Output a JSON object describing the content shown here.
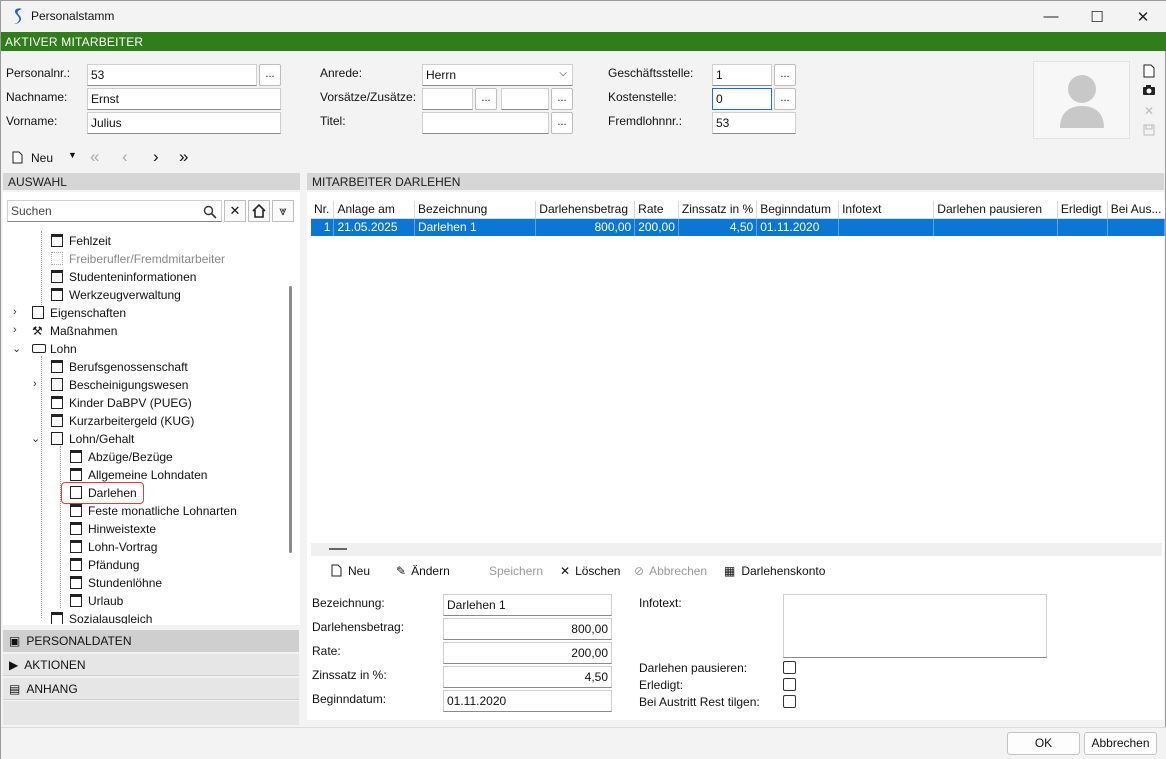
{
  "window": {
    "title": "Personalstamm",
    "minimize": "—",
    "maximize": "☐",
    "close": "✕"
  },
  "header": {
    "active_label": "AKTIVER MITARBEITER"
  },
  "form": {
    "personalnr_label": "Personalnr.:",
    "personalnr_value": "53",
    "nachname_label": "Nachname:",
    "nachname_value": "Ernst",
    "vorname_label": "Vorname:",
    "vorname_value": "Julius",
    "anrede_label": "Anrede:",
    "anrede_value": "Herrn",
    "vorsaetze_label": "Vorsätze/Zusätze:",
    "vorsaetze_value1": "",
    "vorsaetze_value2": "",
    "titel_label": "Titel:",
    "titel_value": "",
    "geschaeftsstelle_label": "Geschäftsstelle:",
    "geschaeftsstelle_value": "1",
    "kostenstelle_label": "Kostenstelle:",
    "kostenstelle_value": "0",
    "fremdlohn_label": "Fremdlohnnr.:",
    "fremdlohn_value": "53",
    "dots": "..."
  },
  "nav": {
    "new_label": "Neu",
    "first": "«",
    "prev": "‹",
    "next": "›",
    "last": "»"
  },
  "left": {
    "section_title": "AUSWAHL",
    "search_placeholder": "Suchen",
    "tree": [
      {
        "label": "Fehlzeit"
      },
      {
        "label": "Freiberufler/Fremdmitarbeiter"
      },
      {
        "label": "Studenteninformationen"
      },
      {
        "label": "Werkzeugverwaltung"
      },
      {
        "label": "Eigenschaften"
      },
      {
        "label": "Maßnahmen"
      },
      {
        "label": "Lohn"
      },
      {
        "label": "Berufsgenossenschaft"
      },
      {
        "label": "Bescheinigungswesen"
      },
      {
        "label": "Kinder DaBPV (PUEG)"
      },
      {
        "label": "Kurzarbeitergeld (KUG)"
      },
      {
        "label": "Lohn/Gehalt"
      },
      {
        "label": "Abzüge/Bezüge"
      },
      {
        "label": "Allgemeine Lohndaten"
      },
      {
        "label": "Darlehen"
      },
      {
        "label": "Feste monatliche Lohnarten"
      },
      {
        "label": "Hinweistexte"
      },
      {
        "label": "Lohn-Vortrag"
      },
      {
        "label": "Pfändung"
      },
      {
        "label": "Stundenlöhne"
      },
      {
        "label": "Urlaub"
      },
      {
        "label": "Sozialausgleich"
      }
    ],
    "accordion": [
      "PERSONALDATEN",
      "AKTIONEN",
      "ANHANG"
    ]
  },
  "right": {
    "section_title": "MITARBEITER DARLEHEN",
    "columns": [
      "Nr.",
      "Anlage am",
      "Bezeichnung",
      "Darlehensbetrag",
      "Rate",
      "Zinssatz in %",
      "Beginndatum",
      "Infotext",
      "Darlehen pausieren",
      "Erledigt",
      "Bei Aus..."
    ],
    "rows": [
      {
        "nr": "1",
        "anlage": "21.05.2025",
        "bezeichnung": "Darlehen 1",
        "betrag": "800,00",
        "rate": "200,00",
        "zins": "4,50",
        "beginn": "01.11.2020",
        "info": "",
        "pausieren": "",
        "erledigt": "",
        "beiaus": ""
      }
    ],
    "toolbar": {
      "neu": "Neu",
      "aendern": "Ändern",
      "speichern": "Speichern",
      "loeschen": "Löschen",
      "abbrechen": "Abbrechen",
      "konto": "Darlehenskonto"
    },
    "detail": {
      "bezeichnung_label": "Bezeichnung:",
      "bezeichnung_value": "Darlehen 1",
      "betrag_label": "Darlehensbetrag:",
      "betrag_value": "800,00",
      "rate_label": "Rate:",
      "rate_value": "200,00",
      "zins_label": "Zinssatz in %:",
      "zins_value": "4,50",
      "beginn_label": "Beginndatum:",
      "beginn_value": "01.11.2020",
      "infotext_label": "Infotext:",
      "infotext_value": "",
      "pausieren_label": "Darlehen pausieren:",
      "erledigt_label": "Erledigt:",
      "austritt_label": "Bei Austritt Rest tilgen:"
    }
  },
  "footer": {
    "ok": "OK",
    "cancel": "Abbrechen"
  },
  "colors": {
    "green": "#2f7d1b",
    "selection": "#0a77d5",
    "highlight_border": "#e0403a"
  }
}
